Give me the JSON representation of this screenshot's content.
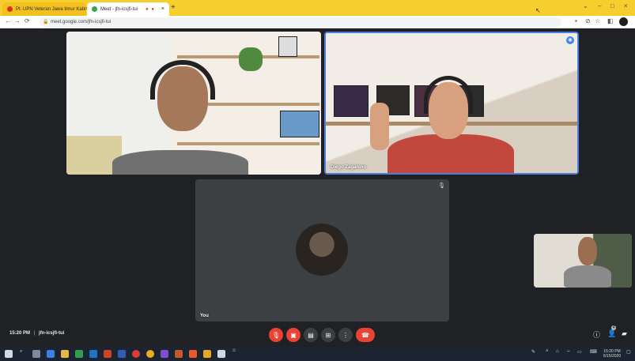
{
  "browser": {
    "tabs": [
      {
        "label": "Pt. UPN Veteran Jawa timur Kabi",
        "active": false
      },
      {
        "label": "Meet - jfn-icsjfi-tui",
        "active": true
      }
    ],
    "url": "meet.google.com/jfn-icsjfi-tui"
  },
  "meet": {
    "participants": [
      {
        "name": ""
      },
      {
        "name": "Diego Zaganino"
      },
      {
        "name": "You"
      }
    ],
    "time": "15:20 PM",
    "meeting_code": "jfn-icsjfi-tui",
    "participant_count": "4"
  },
  "taskbar": {
    "time": "15:20 PM",
    "date": "6/15/2020"
  },
  "colors": {
    "tabbar": "#f7cf2d",
    "meet_bg": "#202124",
    "end_call": "#ea4335",
    "active_speaker": "#4a7fe0"
  }
}
